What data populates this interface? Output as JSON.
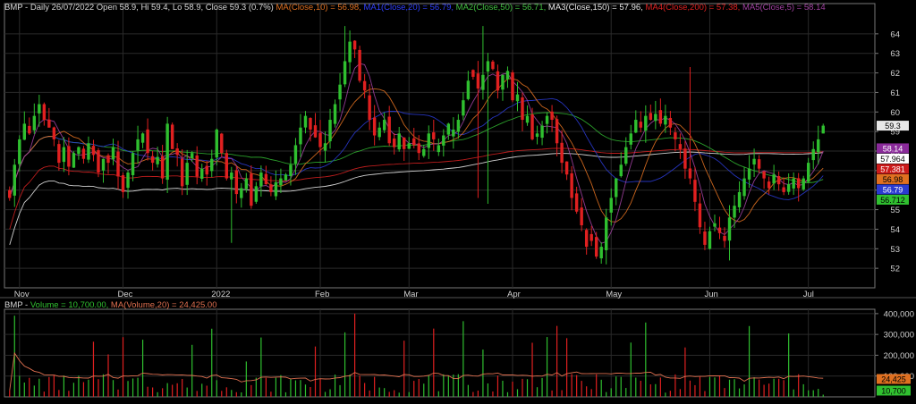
{
  "header": {
    "parts": [
      {
        "text": "BMP - Daily 26/07/2022 Open 58.9, Hi 59.4, Lo 58.9, Close 59.3 (0.7%) ",
        "color": "#d8d8d8"
      },
      {
        "text": "MA(Close,10) = 56.98, ",
        "color": "#e07020"
      },
      {
        "text": "MA1(Close,20) = 56.79, ",
        "color": "#3040ff"
      },
      {
        "text": "MA2(Close,50) = 56.71, ",
        "color": "#40c040"
      },
      {
        "text": "MA3(Close,150) = 57.96, ",
        "color": "#e8e8e8"
      },
      {
        "text": "MA4(Close,200) = 57.38, ",
        "color": "#e02020"
      },
      {
        "text": "MA5(Close,5) = 58.14",
        "color": "#a040a0"
      }
    ]
  },
  "volume_header": {
    "parts": [
      {
        "text": "BMP - ",
        "color": "#d8d8d8"
      },
      {
        "text": "Volume = 10,700.00, ",
        "color": "#30c030"
      },
      {
        "text": "MA(Volume,20) = 24,425.00",
        "color": "#e07050"
      }
    ]
  },
  "colors": {
    "up": "#2fbf2f",
    "down": "#e02020",
    "grid": "#2a2a2a",
    "axis": "#777777"
  },
  "chart_data": [
    {
      "type": "candlestick",
      "ylim": [
        51,
        65
      ],
      "y_ticks": [
        52,
        53,
        54,
        55,
        56,
        57,
        58,
        59,
        60,
        61,
        62,
        63,
        64
      ],
      "x_labels": [
        {
          "label": "Nov",
          "index": 2
        },
        {
          "label": "Dec",
          "index": 23
        },
        {
          "label": "2022",
          "index": 42
        },
        {
          "label": "Feb",
          "index": 63
        },
        {
          "label": "Mar",
          "index": 81
        },
        {
          "label": "Apr",
          "index": 102
        },
        {
          "label": "May",
          "index": 122
        },
        {
          "label": "Jun",
          "index": 142
        },
        {
          "label": "Jul",
          "index": 162
        }
      ],
      "last": {
        "open": 58.9,
        "high": 59.4,
        "low": 58.9,
        "close": 59.3
      },
      "closes": [
        55.6,
        57.3,
        58.6,
        59.4,
        58.9,
        59.8,
        60.4,
        59.6,
        59.2,
        58.6,
        57.4,
        58.2,
        57.2,
        57.9,
        58.2,
        57.6,
        58.4,
        57.8,
        56.9,
        57.6,
        57.4,
        58.2,
        56.7,
        55.9,
        56.9,
        57.9,
        58.6,
        58.9,
        57.9,
        57.4,
        57.7,
        56.6,
        59.4,
        58.1,
        57.8,
        56.2,
        57.4,
        57.9,
        56.7,
        57.1,
        56.8,
        57.6,
        59.1,
        57.9,
        56.6,
        56.9,
        55.8,
        56.1,
        56.6,
        55.2,
        56.2,
        56.9,
        56.3,
        55.9,
        56.4,
        56.6,
        56.8,
        57.3,
        58.3,
        59.2,
        59.8,
        59.1,
        58.7,
        58.2,
        58.4,
        59.6,
        60.4,
        61.4,
        62.6,
        63.6,
        63.2,
        61.6,
        61.1,
        59.6,
        58.8,
        59.2,
        59.6,
        58.4,
        58.2,
        58.9,
        58.1,
        58.4,
        58.3,
        57.9,
        58.1,
        58.9,
        58.6,
        58.3,
        58.8,
        59.4,
        59.1,
        59.6,
        60.6,
        61.6,
        61.8,
        61.2,
        61.9,
        62.6,
        62.2,
        61.1,
        61.9,
        62.1,
        60.6,
        60.9,
        59.6,
        59.8,
        58.6,
        58.9,
        59.3,
        59.8,
        59.6,
        58.4,
        57.4,
        56.8,
        55.6,
        54.9,
        54.2,
        53.1,
        53.4,
        52.6,
        53.1,
        54.6,
        55.6,
        56.6,
        57.3,
        58.2,
        58.9,
        59.6,
        59.2,
        59.8,
        59.6,
        59.9,
        59.4,
        59.8,
        59.2,
        58.6,
        58.1,
        57.1,
        56.6,
        55.4,
        54.1,
        53.2,
        53.9,
        54.3,
        53.8,
        53.4,
        54.6,
        55.2,
        55.9,
        56.6,
        57.1,
        57.6,
        57.1,
        56.6,
        56.1,
        56.8,
        56.3,
        55.9,
        56.3,
        56.6,
        56.1,
        56.6,
        57.4,
        58.1,
        58.6,
        59.3
      ],
      "markers": [
        {
          "label": "59.3",
          "value": 59.3,
          "bg": "#e8e8e8",
          "fg": "#000000"
        },
        {
          "label": "58.14",
          "value": 58.14,
          "bg": "#8a2a9a",
          "fg": "#ffffff"
        },
        {
          "label": "57.964",
          "value": 57.964,
          "bg": "#ffffff",
          "fg": "#000000"
        },
        {
          "label": "57.381",
          "value": 57.381,
          "bg": "#cc1a1a",
          "fg": "#ffffff"
        },
        {
          "label": "56.98",
          "value": 56.98,
          "bg": "#e07020",
          "fg": "#000000"
        },
        {
          "label": "56.79",
          "value": 56.79,
          "bg": "#2a3ad0",
          "fg": "#ffffff"
        },
        {
          "label": "56.712",
          "value": 56.712,
          "bg": "#30c030",
          "fg": "#000000"
        }
      ]
    },
    {
      "type": "bar",
      "title": "Volume",
      "ylim": [
        0,
        400000
      ],
      "y_ticks": [
        100000,
        200000,
        300000,
        400000
      ],
      "y_tick_labels": [
        "100,000",
        "200,000",
        "300,000",
        "400,000"
      ],
      "last_volume": 10700,
      "last_ma": 24425,
      "markers": [
        {
          "label": "24,425",
          "value": 24425,
          "bg": "#e07020",
          "fg": "#000000"
        },
        {
          "label": "10,700",
          "value": 10700,
          "bg": "#30c030",
          "fg": "#000000"
        }
      ]
    }
  ]
}
